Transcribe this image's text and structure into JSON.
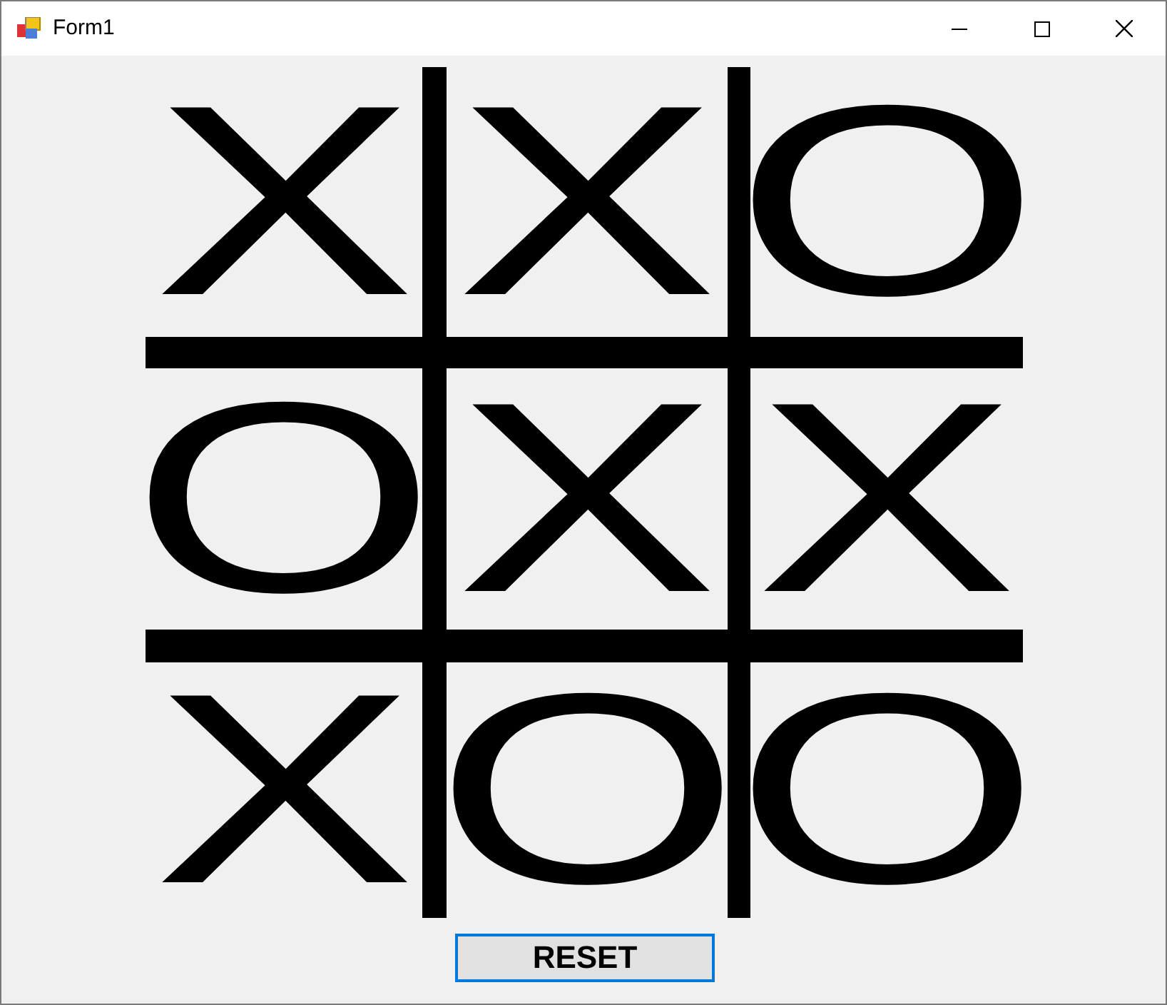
{
  "window": {
    "title": "Form1"
  },
  "board": [
    {
      "mark": "X"
    },
    {
      "mark": "X"
    },
    {
      "mark": "O"
    },
    {
      "mark": "O"
    },
    {
      "mark": "X"
    },
    {
      "mark": "X"
    },
    {
      "mark": "X"
    },
    {
      "mark": "O"
    },
    {
      "mark": "O"
    }
  ],
  "reset_button": {
    "label": "RESET",
    "focused": true
  }
}
